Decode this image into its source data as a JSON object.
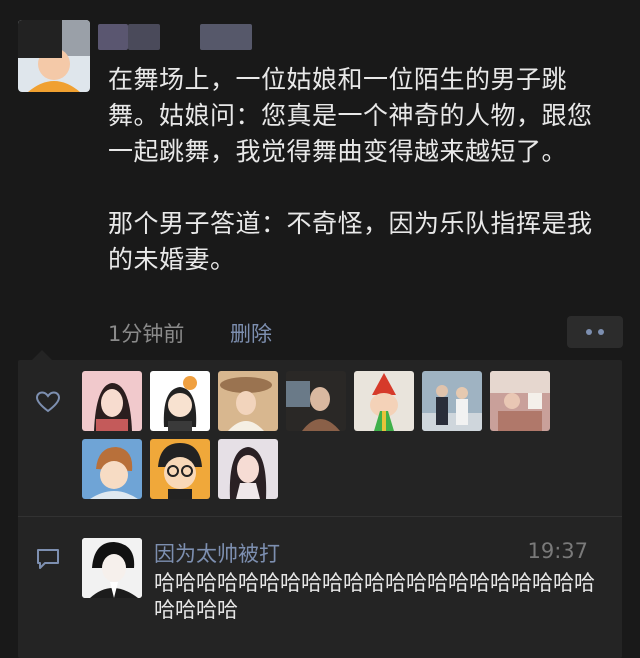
{
  "post": {
    "text": "在舞场上，一位姑娘和一位陌生的男子跳舞。姑娘问：您真是一个神奇的人物，跟您一起跳舞，我觉得舞曲变得越来越短了。\n\n那个男子答道：不奇怪，因为乐队指挥是我的未婚妻。",
    "time": "1分钟前",
    "delete_label": "删除",
    "more_icon": "more-dots-icon"
  },
  "likes": {
    "icon": "heart-icon",
    "count_shown": 10
  },
  "comment": {
    "icon": "comment-icon",
    "author": "因为太帅被打",
    "time": "19:37",
    "text": "哈哈哈哈哈哈哈哈哈哈哈哈哈哈哈哈哈哈哈哈哈哈哈哈哈"
  },
  "colors": {
    "background": "#191919",
    "panel": "#242424",
    "link": "#7d8fb0",
    "muted": "#8a8a8a"
  }
}
